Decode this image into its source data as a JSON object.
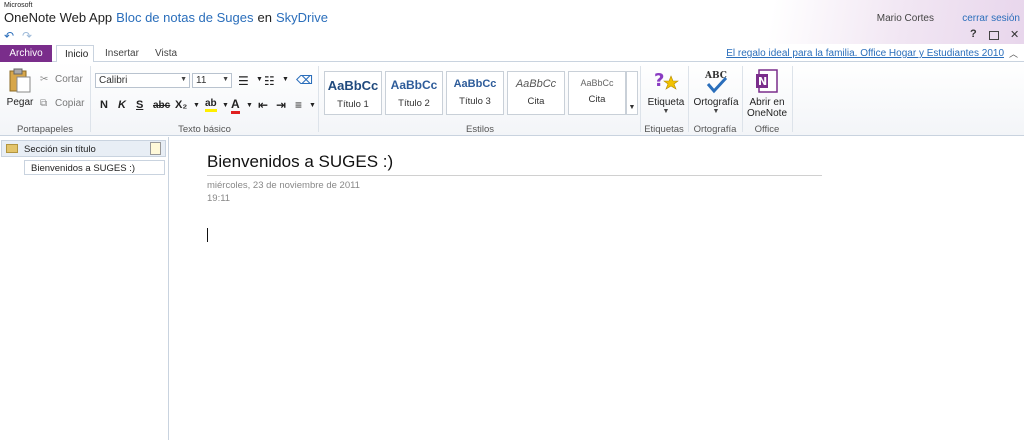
{
  "header": {
    "microsoft": "Microsoft",
    "app_name": "OneNote Web App",
    "notebook": "Bloc de notas de Suges",
    "connector": "en",
    "service": "SkyDrive",
    "user": "Mario Cortes",
    "sign_out": "cerrar sesión"
  },
  "tabs": {
    "file": "Archivo",
    "home": "Inicio",
    "insert": "Insertar",
    "view": "Vista"
  },
  "promo": "El regalo ideal para la familia. Office Hogar y Estudiantes 2010",
  "ribbon": {
    "clipboard": {
      "paste": "Pegar",
      "cut": "Cortar",
      "copy": "Copiar",
      "label": "Portapapeles"
    },
    "text": {
      "font": "Calibri",
      "size": "11",
      "bold": "N",
      "italic": "K",
      "underline": "S",
      "strike": "abc",
      "subscript": "X₂",
      "label": "Texto básico"
    },
    "styles": {
      "items": [
        {
          "sample": "AaBbCc",
          "name": "Título 1"
        },
        {
          "sample": "AaBbCc",
          "name": "Título 2"
        },
        {
          "sample": "AaBbCc",
          "name": "Título 3"
        },
        {
          "sample": "AaBbCc",
          "name": "Cita"
        },
        {
          "sample": "AaBbCc",
          "name": "Cita"
        }
      ],
      "label": "Estilos"
    },
    "tags": {
      "button": "Etiqueta",
      "label": "Etiquetas"
    },
    "spelling": {
      "button": "Ortografía",
      "label": "Ortografía"
    },
    "office": {
      "button_line1": "Abrir en",
      "button_line2": "OneNote",
      "label": "Office"
    }
  },
  "sidebar": {
    "section": "Sección sin título",
    "page": "Bienvenidos a SUGES :)"
  },
  "page": {
    "title": "Bienvenidos a SUGES :)",
    "date": "miércoles, 23 de noviembre de 2011",
    "time": "19:11"
  }
}
